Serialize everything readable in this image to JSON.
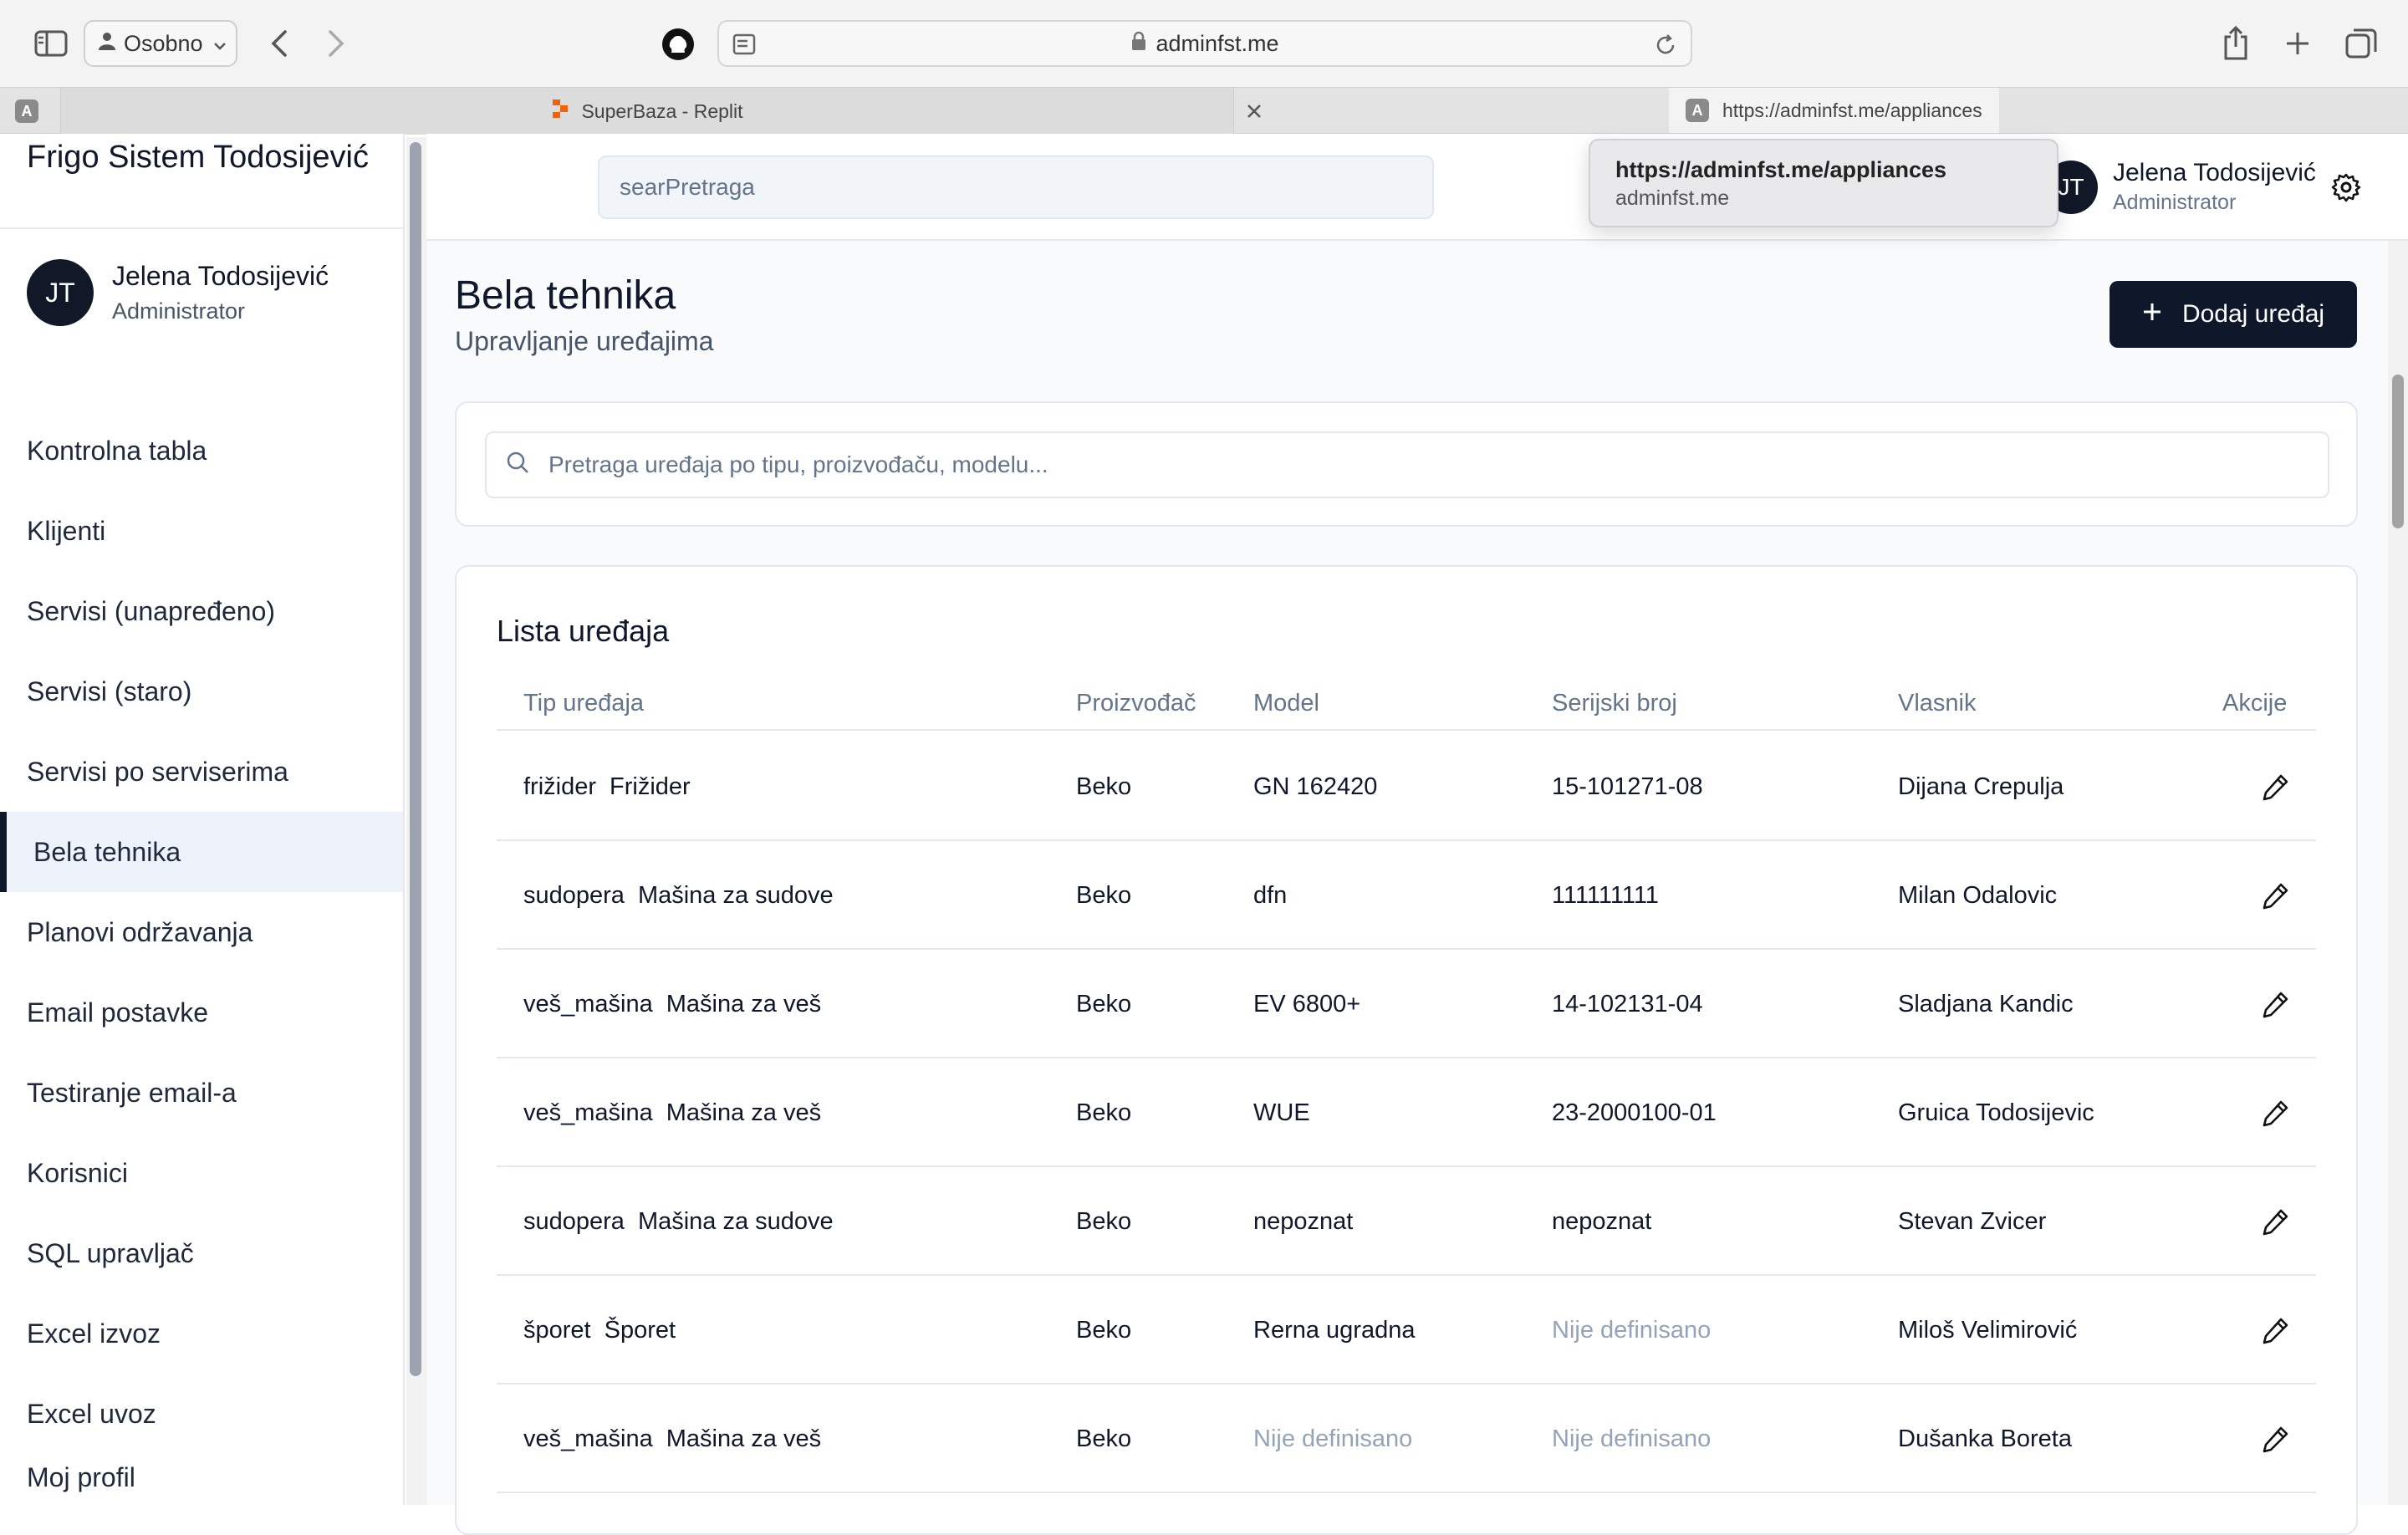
{
  "browser": {
    "profile": "Osobno",
    "address": "adminfst.me",
    "tabs": [
      {
        "label": "SuperBaza - Replit"
      },
      {
        "label": "https://adminfst.me/appliances"
      }
    ],
    "tab_favicon_letter": "A",
    "tooltip": {
      "url": "https://adminfst.me/appliances",
      "host": "adminfst.me"
    }
  },
  "sidebar": {
    "brand": "Frigo Sistem Todosijević",
    "user": {
      "initials": "JT",
      "name": "Jelena Todosijević",
      "role": "Administrator"
    },
    "items": [
      {
        "label": "Kontrolna tabla"
      },
      {
        "label": "Klijenti"
      },
      {
        "label": "Servisi (unapređeno)"
      },
      {
        "label": "Servisi (staro)"
      },
      {
        "label": "Servisi po serviserima"
      },
      {
        "label": "Bela tehnika",
        "active": true
      },
      {
        "label": "Planovi održavanja"
      },
      {
        "label": "Email postavke"
      },
      {
        "label": "Testiranje email-a"
      },
      {
        "label": "Korisnici"
      },
      {
        "label": "SQL upravljač"
      },
      {
        "label": "Excel izvoz"
      },
      {
        "label": "Excel uvoz"
      },
      {
        "label": "Moj profil"
      }
    ]
  },
  "header": {
    "search_text": "searPretraga",
    "user": {
      "initials": "JT",
      "name": "Jelena Todosijević",
      "role": "Administrator"
    }
  },
  "page": {
    "title": "Bela tehnika",
    "subtitle": "Upravljanje uređajima",
    "add_button": "Dodaj uređaj",
    "search_placeholder": "Pretraga uređaja po tipu, proizvođaču, modelu..."
  },
  "table": {
    "title": "Lista uređaja",
    "columns": [
      "Tip uređaja",
      "Proizvođač",
      "Model",
      "Serijski broj",
      "Vlasnik",
      "Akcije"
    ],
    "rows": [
      {
        "code": "frižider",
        "type": "Frižider",
        "maker": "Beko",
        "model": "GN 162420",
        "serial": "15-101271-08",
        "owner": "Dijana Crepulja"
      },
      {
        "code": "sudopera",
        "type": "Mašina za sudove",
        "maker": "Beko",
        "model": "dfn",
        "serial": "111111111",
        "owner": "Milan Odalovic"
      },
      {
        "code": "veš_mašina",
        "type": "Mašina za veš",
        "maker": "Beko",
        "model": "EV 6800+",
        "serial": "14-102131-04",
        "owner": "Sladjana Kandic"
      },
      {
        "code": "veš_mašina",
        "type": "Mašina za veš",
        "maker": "Beko",
        "model": "WUE",
        "serial": "23-2000100-01",
        "owner": "Gruica Todosijevic"
      },
      {
        "code": "sudopera",
        "type": "Mašina za sudove",
        "maker": "Beko",
        "model": "nepoznat",
        "serial": "nepoznat",
        "owner": "Stevan Zvicer"
      },
      {
        "code": "šporet",
        "type": "Šporet",
        "maker": "Beko",
        "model": "Rerna ugradna",
        "serial": "Nije definisano",
        "owner": "Miloš Velimirović"
      },
      {
        "code": "veš_mašina",
        "type": "Mašina za veš",
        "maker": "Beko",
        "model": "Nije definisano",
        "serial": "Nije definisano",
        "owner": "Dušanka Boreta"
      }
    ],
    "muted_value": "Nije definisano"
  },
  "colors": {
    "accent": "#0f172a",
    "active_bg": "#eef2fb",
    "muted": "#94a3b8"
  }
}
